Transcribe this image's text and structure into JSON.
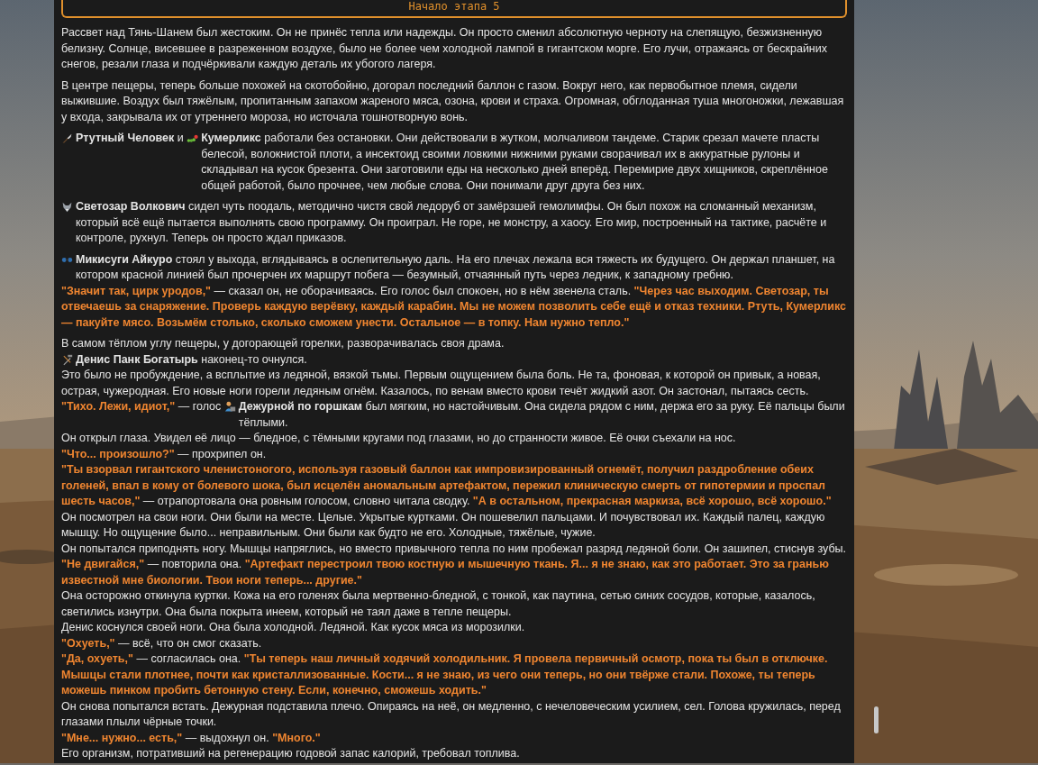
{
  "header": {
    "title": "Начало этапа 5"
  },
  "paragraphs": [
    {
      "lines": [
        [
          {
            "kind": "plain",
            "text": "Рассвет над Тянь-Шанем был жестоким. Он не принёс тепла или надежды. Он просто сменил абсолютную черноту на слепящую, безжизненную белизну. Солнце, висевшее в разреженном воздухе, было не более чем холодной лампой в гигантском морге. Его лучи, отражаясь от бескрайних снегов, резали глаза и подчёркивали каждую деталь их убогого лагеря."
          }
        ]
      ]
    },
    {
      "lines": [
        [
          {
            "kind": "plain",
            "text": "В центре пещеры, теперь больше похожей на скотобойню, догорал последний баллон с газом. Вокруг него, как первобытное племя, сидели выжившие. Воздух был тяжёлым, пропитанным запахом жареного мяса, озона, крови и страха. Огромная, обглоданная туша многоножки, лежавшая у входа, закрывала их от утреннего мороза, но источала тошнотворную вонь."
          }
        ]
      ]
    },
    {
      "lines": [
        [
          {
            "kind": "icon"
          },
          {
            "kind": "bold",
            "text": "Ртутный Человек"
          },
          {
            "kind": "plain",
            "text": " и "
          },
          {
            "kind": "icon"
          },
          {
            "kind": "bold",
            "text": "Кумерликс"
          },
          {
            "kind": "plain",
            "text": " работали без остановки. Они действовали в жутком, молчаливом тандеме. Старик срезал мачете пласты белесой, волокнистой плоти, а инсектоид своими ловкими нижними руками сворачивал их в аккуратные рулоны и складывал на кусок брезента. Они заготовили еды на несколько дней вперёд. Перемирие двух хищников, скреплённое общей работой, было прочнее, чем любые слова. Они понимали друг друга без них."
          }
        ]
      ]
    },
    {
      "lines": [
        [
          {
            "kind": "icon"
          },
          {
            "kind": "bold",
            "text": "Светозар Волкович"
          },
          {
            "kind": "plain",
            "text": " сидел чуть поодаль, методично чистя свой ледоруб от замёрзшей гемолимфы. Он был похож на сломанный механизм, который всё ещё пытается выполнять свою программу. Он проиграл. Не горе, не монстру, а хаосу. Его мир, построенный на тактике, расчёте и контроле, рухнул. Теперь он просто ждал приказов."
          }
        ]
      ]
    },
    {
      "lines": [
        [
          {
            "kind": "icon"
          },
          {
            "kind": "bold",
            "text": "Микисуги Айкуро"
          },
          {
            "kind": "plain",
            "text": " стоял у выхода, вглядываясь в ослепительную даль. На его плечах лежала вся тяжесть их будущего. Он держал планшет, на котором красной линией был прочерчен их маршрут побега — безумный, отчаянный путь через ледник, к западному гребню."
          }
        ],
        [
          {
            "kind": "speech",
            "text": "\"Значит так, цирк уродов,\""
          },
          {
            "kind": "plain",
            "text": " — сказал он, не оборачиваясь. Его голос был спокоен, но в нём звенела сталь. "
          },
          {
            "kind": "speech",
            "text": "\"Через час выходим. Светозар, ты отвечаешь за снаряжение. Проверь каждую верёвку, каждый карабин. Мы не можем позволить себе ещё и отказ техники. Ртуть, Кумерликс — пакуйте мясо. Возьмём столько, сколько сможем унести. Остальное — в топку. Нам нужно тепло.\""
          }
        ]
      ]
    },
    {
      "lines": [
        [
          {
            "kind": "plain",
            "text": "В самом тёплом углу пещеры, у догорающей горелки, разворачивалась своя драма."
          }
        ],
        [
          {
            "kind": "icon"
          },
          {
            "kind": "bold",
            "text": "Денис Панк Богатырь"
          },
          {
            "kind": "plain",
            "text": " наконец-то очнулся."
          }
        ],
        [
          {
            "kind": "plain",
            "text": "Это было не пробуждение, а всплытие из ледяной, вязкой тьмы. Первым ощущением была боль. Не та, фоновая, к которой он привык, а новая, острая, чужеродная. Его новые ноги горели ледяным огнём. Казалось, по венам вместо крови течёт жидкий азот. Он застонал, пытаясь сесть."
          }
        ],
        [
          {
            "kind": "speech",
            "text": "\"Тихо. Лежи, идиот,\""
          },
          {
            "kind": "plain",
            "text": " — голос "
          },
          {
            "kind": "icon"
          },
          {
            "kind": "bold",
            "text": "Дежурной по горшкам"
          },
          {
            "kind": "plain",
            "text": " был мягким, но настойчивым. Она сидела рядом с ним, держа его за руку. Её пальцы были тёплыми."
          }
        ],
        [
          {
            "kind": "plain",
            "text": "Он открыл глаза. Увидел её лицо — бледное, с тёмными кругами под глазами, но до странности живое. Её очки съехали на нос."
          }
        ],
        [
          {
            "kind": "speech",
            "text": "\"Что... произошло?\""
          },
          {
            "kind": "plain",
            "text": " — прохрипел он."
          }
        ],
        [
          {
            "kind": "speech",
            "text": "\"Ты взорвал гигантского членистоногого, используя газовый баллон как импровизированный огнемёт, получил раздробление обеих голеней, впал в кому от болевого шока, был исцелён аномальным артефактом, пережил клиническую смерть от гипотермии и проспал шесть часов,\""
          },
          {
            "kind": "plain",
            "text": " — отрапортовала она ровным голосом, словно читала сводку. "
          },
          {
            "kind": "speech",
            "text": "\"А в остальном, прекрасная маркиза, всё хорошо, всё хорошо.\""
          }
        ],
        [
          {
            "kind": "plain",
            "text": "Он посмотрел на свои ноги. Они были на месте. Целые. Укрытые куртками. Он пошевелил пальцами. И почувствовал их. Каждый палец, каждую мышцу. Но ощущение было... неправильным. Они были как будто не его. Холодные, тяжёлые, чужие."
          }
        ],
        [
          {
            "kind": "plain",
            "text": "Он попытался приподнять ногу. Мышцы напряглись, но вместо привычного тепла по ним пробежал разряд ледяной боли. Он зашипел, стиснув зубы."
          }
        ],
        [
          {
            "kind": "speech",
            "text": "\"Не двигайся,\""
          },
          {
            "kind": "plain",
            "text": " — повторила она. "
          },
          {
            "kind": "speech",
            "text": "\"Артефакт перестроил твою костную и мышечную ткань. Я... я не знаю, как это работает. Это за гранью известной мне биологии. Твои ноги теперь... другие.\""
          }
        ],
        [
          {
            "kind": "plain",
            "text": "Она осторожно откинула куртки. Кожа на его голенях была мертвенно-бледной, с тонкой, как паутина, сетью синих сосудов, которые, казалось, светились изнутри. Она была покрыта инеем, который не таял даже в тепле пещеры."
          }
        ],
        [
          {
            "kind": "plain",
            "text": "Денис коснулся своей ноги. Она была холодной. Ледяной. Как кусок мяса из морозилки."
          }
        ],
        [
          {
            "kind": "speech",
            "text": "\"Охуеть,\""
          },
          {
            "kind": "plain",
            "text": " — всё, что он смог сказать."
          }
        ],
        [
          {
            "kind": "speech",
            "text": "\"Да, охуеть,\""
          },
          {
            "kind": "plain",
            "text": " — согласилась она. "
          },
          {
            "kind": "speech",
            "text": "\"Ты теперь наш личный ходячий холодильник. Я провела первичный осмотр, пока ты был в отключке. Мышцы стали плотнее, почти как кристаллизованные. Кости... я не знаю, из чего они теперь, но они твёрже стали. Похоже, ты теперь можешь пинком пробить бетонную стену. Если, конечно, сможешь ходить.\""
          }
        ],
        [
          {
            "kind": "plain",
            "text": "Он снова попытался встать. Дежурная подставила плечо. Опираясь на неё, он медленно, с нечеловеческим усилием, сел. Голова кружилась, перед глазами плыли чёрные точки."
          }
        ],
        [
          {
            "kind": "speech",
            "text": "\"Мне... нужно... есть,\""
          },
          {
            "kind": "plain",
            "text": " — выдохнул он. "
          },
          {
            "kind": "speech",
            "text": "\"Много.\""
          }
        ],
        [
          {
            "kind": "plain",
            "text": "Его организм, потративший на регенерацию годовой запас калорий, требовал топлива."
          }
        ]
      ]
    }
  ]
}
